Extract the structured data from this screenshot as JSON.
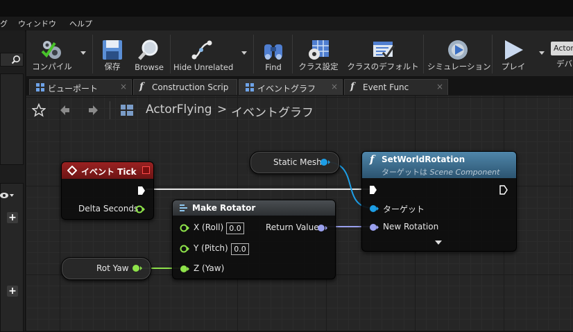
{
  "menu": {
    "items": [
      "グ",
      "ウィンドウ",
      "ヘルプ"
    ]
  },
  "toolbar": {
    "compile": "コンパイル",
    "save": "保存",
    "browse": "Browse",
    "hide_unrelated": "Hide Unrelated",
    "find": "Find",
    "class_settings": "クラス設定",
    "class_defaults": "クラスのデフォルト",
    "simulation": "シミュレーション",
    "play": "プレイ",
    "debug_select_value": "Actor",
    "debug_label": "デバ"
  },
  "tabs": [
    {
      "label": "ビューポート"
    },
    {
      "label": "Construction Scrip"
    },
    {
      "label": "イベントグラフ"
    },
    {
      "label": "Event Func"
    }
  ],
  "breadcrumb": {
    "actor": "ActorFlying",
    "separator": ">",
    "graph": "イベントグラフ"
  },
  "nodes": {
    "event_tick": {
      "title": "イベント Tick",
      "delta": "Delta Seconds"
    },
    "make_rotator": {
      "title": "Make Rotator",
      "x_label": "X (Roll)",
      "x_value": "0.0",
      "y_label": "Y (Pitch)",
      "y_value": "0.0",
      "z_label": "Z (Yaw)",
      "return": "Return Value"
    },
    "static_mesh": {
      "label": "Static Mesh"
    },
    "rot_yaw": {
      "label": "Rot Yaw"
    },
    "set_world_rotation": {
      "title": "SetWorldRotation",
      "subtitle_prefix": "ターゲットは",
      "subtitle_class": "Scene Component",
      "target": "ターゲット",
      "new_rotation": "New Rotation"
    }
  },
  "colors": {
    "event_header": "#8b1c1c",
    "function_header": "#3e6f8f",
    "exec_wire": "#e8e8e8",
    "object_pin": "#1d9ee6",
    "rotator_pin": "#9aa0ee",
    "float_pin": "#8ee34a"
  }
}
